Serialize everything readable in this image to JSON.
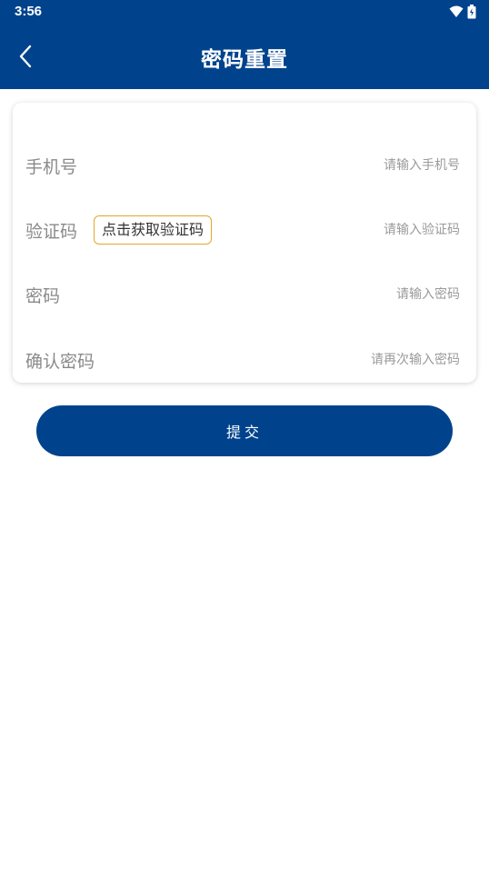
{
  "status_bar": {
    "time": "3:56",
    "icons": [
      "wifi-icon",
      "battery-icon"
    ]
  },
  "header": {
    "title": "密码重置",
    "back_icon": "chevron-left-icon",
    "background_color": "#00438c"
  },
  "form": {
    "phone": {
      "label": "手机号",
      "placeholder": "请输入手机号",
      "value": ""
    },
    "code": {
      "label": "验证码",
      "button_label": "点击获取验证码",
      "placeholder": "请输入验证码",
      "value": ""
    },
    "password": {
      "label": "密码",
      "placeholder": "请输入密码",
      "value": ""
    },
    "confirm_password": {
      "label": "确认密码",
      "placeholder": "请再次输入密码",
      "value": ""
    }
  },
  "submit": {
    "label": "提交"
  },
  "colors": {
    "primary": "#00438c",
    "code_button_border": "#e3a72a",
    "label": "#8a8a8a",
    "placeholder": "#9a9a9a"
  }
}
